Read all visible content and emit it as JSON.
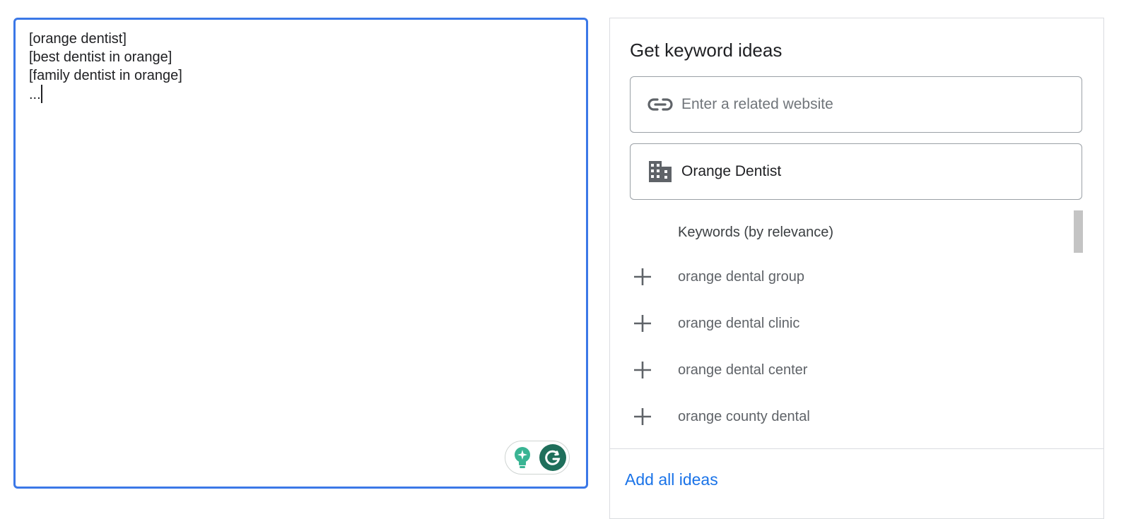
{
  "editor": {
    "lines": [
      "[orange dentist]",
      "[best dentist in orange]",
      "[family dentist in orange]",
      "..."
    ]
  },
  "assistant": {
    "bulb_icon": "lightbulb-sparkle-icon",
    "grammarly_icon": "grammarly-g-icon",
    "grammarly_color": "#1f6f5b"
  },
  "panel": {
    "title": "Get keyword ideas",
    "website_field": {
      "icon": "link-icon",
      "value": "",
      "placeholder": "Enter a related website"
    },
    "business_field": {
      "icon": "business-building-icon",
      "value": "Orange Dentist"
    },
    "ideas_header": "Keywords (by relevance)",
    "ideas": [
      {
        "label": "orange dental group",
        "icon": "plus-icon"
      },
      {
        "label": "orange dental clinic",
        "icon": "plus-icon"
      },
      {
        "label": "orange dental center",
        "icon": "plus-icon"
      },
      {
        "label": "orange county dental",
        "icon": "plus-icon"
      }
    ],
    "add_all_label": "Add all ideas"
  },
  "colors": {
    "accent": "#1a73e8",
    "editor_border": "#3b78e7",
    "muted_text": "#5f6368"
  }
}
